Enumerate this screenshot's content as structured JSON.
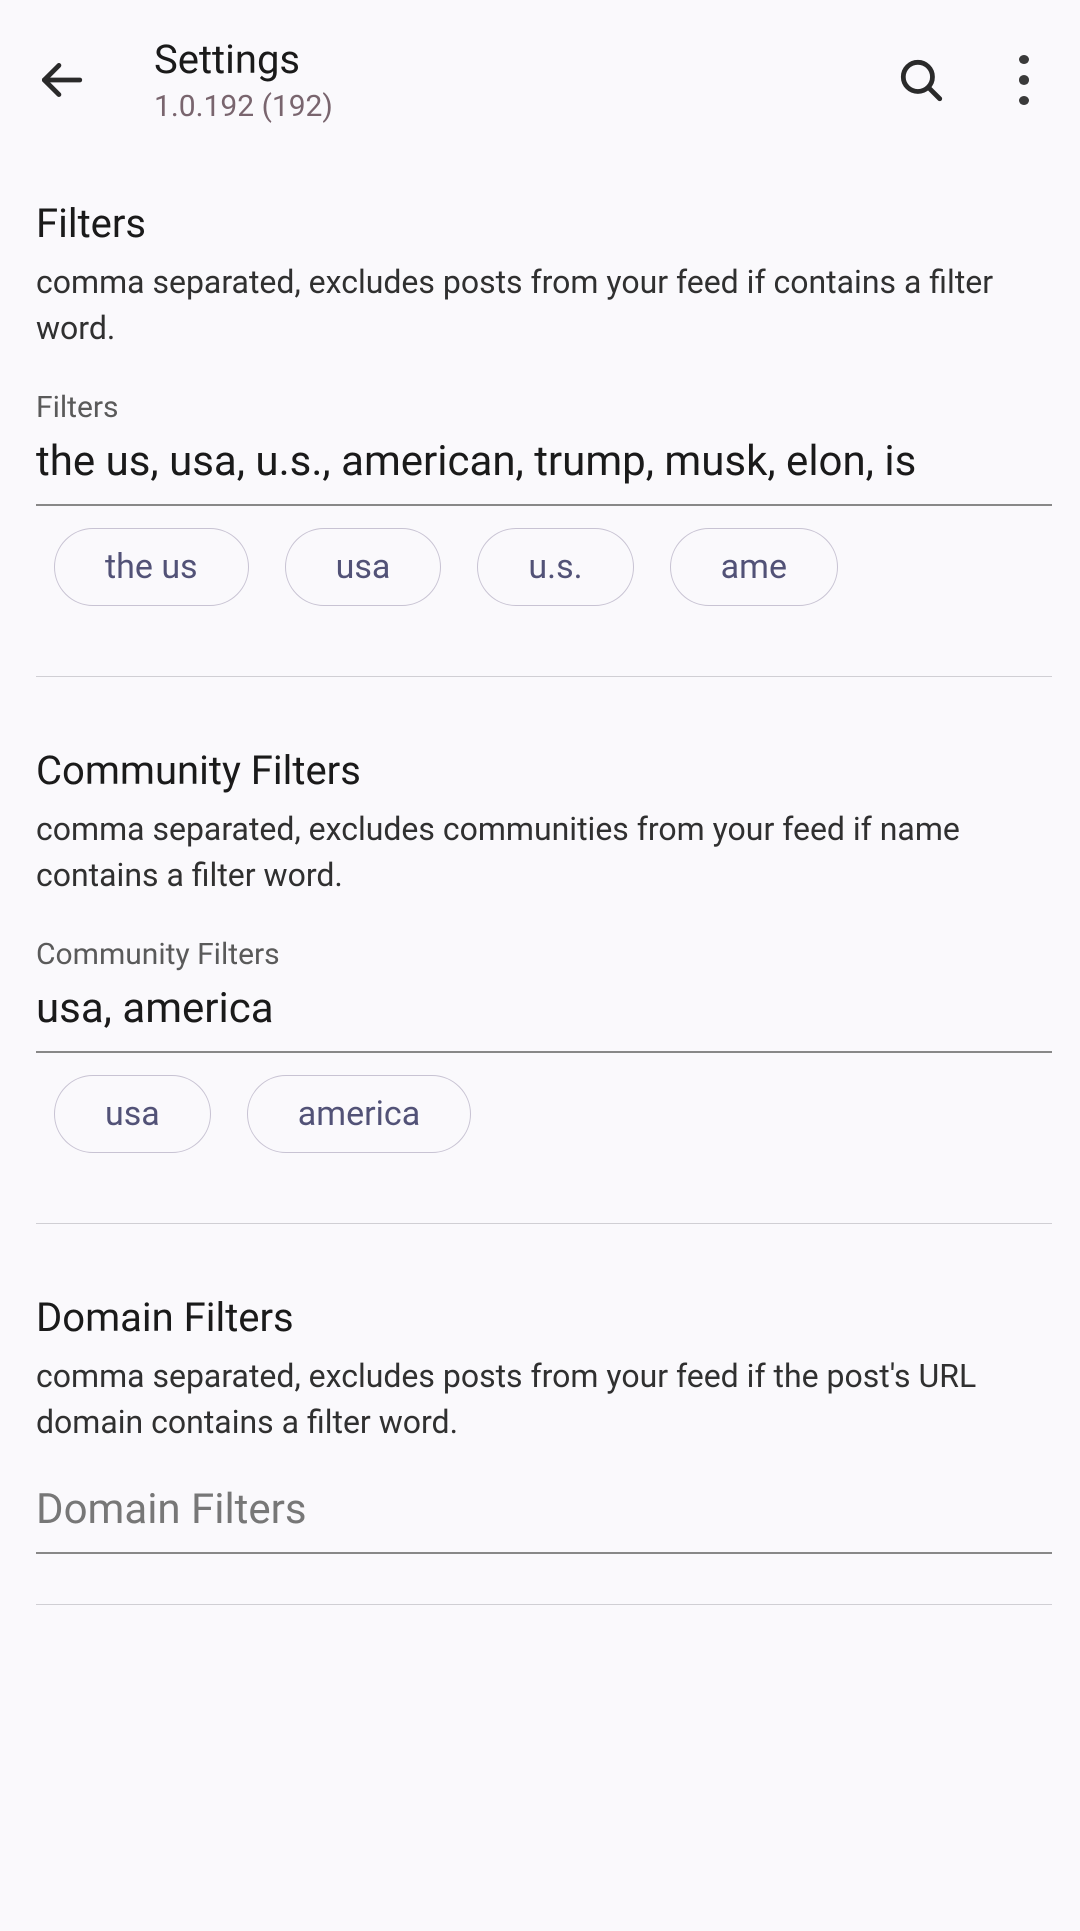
{
  "header": {
    "title": "Settings",
    "subtitle": "1.0.192 (192)"
  },
  "sections": {
    "filters": {
      "title": "Filters",
      "desc": "comma separated, excludes posts from your feed if contains a filter word.",
      "label": "Filters",
      "value": "the us, usa, u.s., american, trump, musk, elon, is",
      "chips": [
        "the us",
        "usa",
        "u.s.",
        "ame"
      ]
    },
    "community": {
      "title": "Community Filters",
      "desc": "comma separated, excludes communities from your feed if name contains a filter word.",
      "label": "Community Filters",
      "value": "usa, america",
      "chips": [
        "usa",
        "america"
      ]
    },
    "domain": {
      "title": "Domain Filters",
      "desc": "comma separated, excludes posts from your feed if the post's URL domain contains a filter word.",
      "placeholder": "Domain Filters"
    }
  }
}
